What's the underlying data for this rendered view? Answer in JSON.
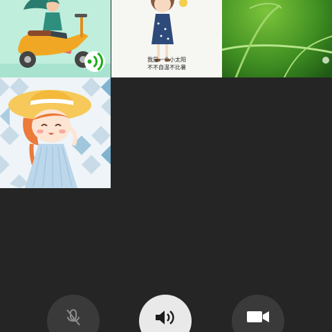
{
  "participants": [
    {
      "name": "participant-scooter-girl",
      "speaking": true,
      "icon": "sound-wave-icon"
    },
    {
      "name": "participant-sun-girl",
      "caption_lines": [
        "我是一个小太阳",
        "不不自温不比暑"
      ]
    },
    {
      "name": "participant-grass-dew"
    },
    {
      "name": "participant-straw-hat-girl"
    }
  ],
  "controls": {
    "mic": {
      "icon": "mic-muted-icon",
      "state": "muted"
    },
    "speaker": {
      "icon": "speaker-icon",
      "state": "on"
    },
    "camera": {
      "icon": "video-camera-icon",
      "state": "on"
    }
  },
  "colors": {
    "background": "#252525",
    "speaking_badge": "#1aad19",
    "button_dark": "#3a3a3a",
    "button_light": "#e9e9e9"
  }
}
